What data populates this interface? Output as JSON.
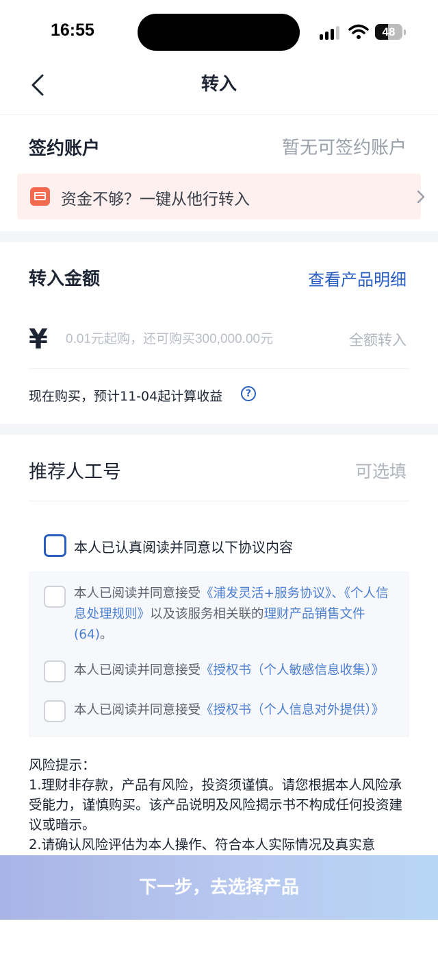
{
  "status": {
    "time": "16:55",
    "battery": "48",
    "battery_level": 0.48
  },
  "nav": {
    "title": "转入"
  },
  "account": {
    "label": "签约账户",
    "value": "暂无可签约账户"
  },
  "banner": {
    "text": "资金不够？一键从他行转入"
  },
  "amount": {
    "label": "转入金额",
    "detail_link": "查看产品明细",
    "currency_symbol": "¥",
    "placeholder": "0.01元起购，还可购买300,000.00元",
    "all_button": "全额转入",
    "estimate": "现在购买，预计11-04起计算收益",
    "help_symbol": "?"
  },
  "referrer": {
    "label": "推荐人工号",
    "placeholder": "可选填"
  },
  "agreements": {
    "main": "本人已认真阅读并同意以下协议内容",
    "items": [
      {
        "prefix": "本人已阅读并同意接受",
        "link1": "《浦发灵活+服务协议》、《个人信息处理规则》",
        "middle": "以及该服务相关联的",
        "link2": "理财产品销售文件(64)",
        "suffix": "。"
      },
      {
        "prefix": "本人已阅读并同意接受",
        "link1": "《授权书（个人敏感信息收集）》"
      },
      {
        "prefix": "本人已阅读并同意接受",
        "link1": "《授权书（个人信息对外提供）》"
      }
    ]
  },
  "risk": {
    "title": "风险提示：",
    "line1": "1.理财非存款，产品有风险，投资须谨慎。请您根据本人风险承受能力，谨慎购买。该产品说明及风险揭示书不构成任何投资建议或暗示。",
    "line2": "2.请确认风险评估为本人操作、符合本人实际情况及真实意"
  },
  "footer": {
    "next_label": "下一步，去选择产品"
  },
  "colors": {
    "accent": "#2a5fc2",
    "banner_bg": "#fdf0ee",
    "banner_icon": "#f26a4f"
  }
}
